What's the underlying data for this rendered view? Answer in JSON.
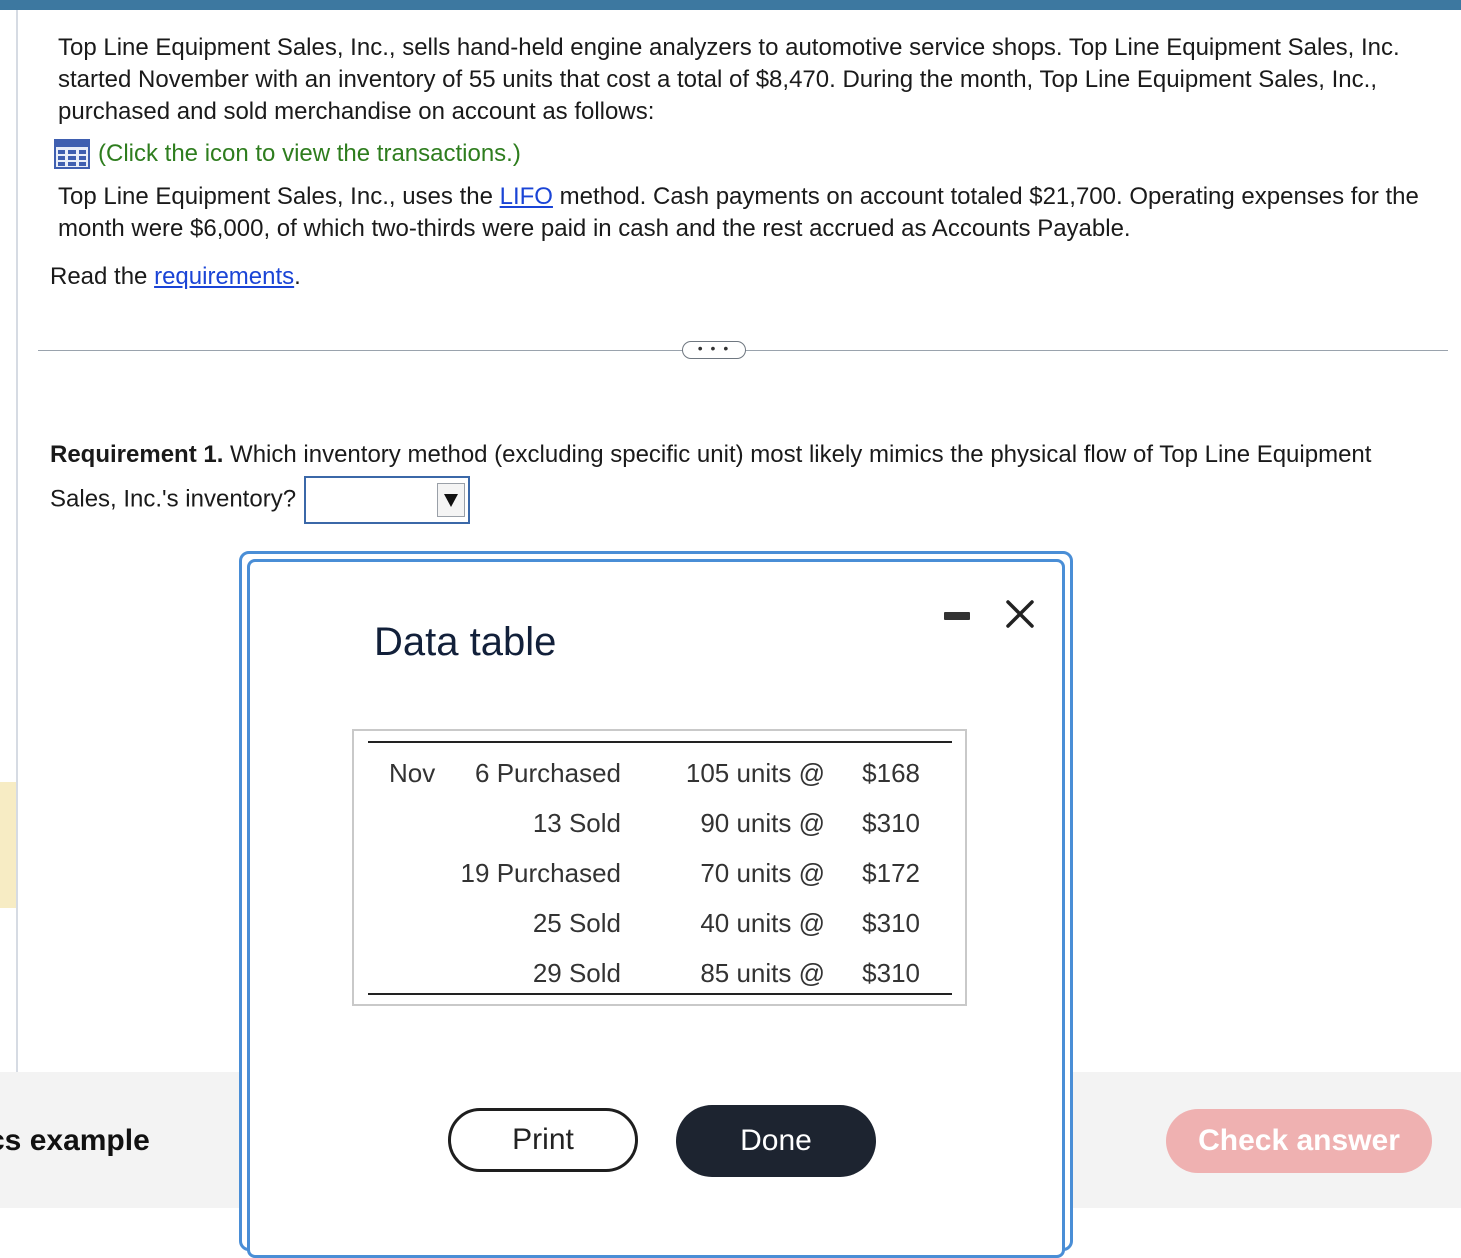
{
  "problem": {
    "paragraph1": "Top Line Equipment Sales, Inc., sells hand-held engine analyzers to automotive service shops. Top Line Equipment Sales, Inc. started November with an inventory of 55 units that cost a total of $8,470. During the month, Top Line Equipment Sales, Inc., purchased and sold merchandise on account as follows:",
    "icon_link_text": "(Click the icon to view the transactions.)",
    "paragraph2_before": "Top Line Equipment Sales, Inc., uses the ",
    "paragraph2_link": "LIFO",
    "paragraph2_after": " method. Cash payments on account totaled $21,700. Operating expenses for the month were $6,000, of which two-thirds were paid in cash and the rest accrued as Accounts Payable.",
    "read_prefix": "Read the ",
    "read_link": "requirements",
    "read_suffix": "."
  },
  "more_button": "• • •",
  "requirement": {
    "label": "Requirement 1.",
    "question": " Which inventory method (excluding specific unit) most likely mimics the physical flow of Top Line Equipment Sales, Inc.'s inventory?",
    "dropdown_value": ""
  },
  "bottom": {
    "title": "cs example",
    "check_answer": "Check answer"
  },
  "modal": {
    "title": "Data table",
    "rows": [
      {
        "month": "Nov",
        "event": "6 Purchased",
        "units": "105 units @",
        "price": "$168"
      },
      {
        "month": "",
        "event": "13 Sold",
        "units": "90 units @",
        "price": "$310"
      },
      {
        "month": "",
        "event": "19 Purchased",
        "units": "70 units @",
        "price": "$172"
      },
      {
        "month": "",
        "event": "25 Sold",
        "units": "40 units @",
        "price": "$310"
      },
      {
        "month": "",
        "event": "29 Sold",
        "units": "85 units @",
        "price": "$310"
      }
    ],
    "print_label": "Print",
    "done_label": "Done"
  },
  "colors": {
    "link": "#1a44d6",
    "icon_link": "#2e7d1e",
    "modal_border": "#4a8ed6",
    "done_button": "#1d2430",
    "check_button": "#efb1b1"
  }
}
